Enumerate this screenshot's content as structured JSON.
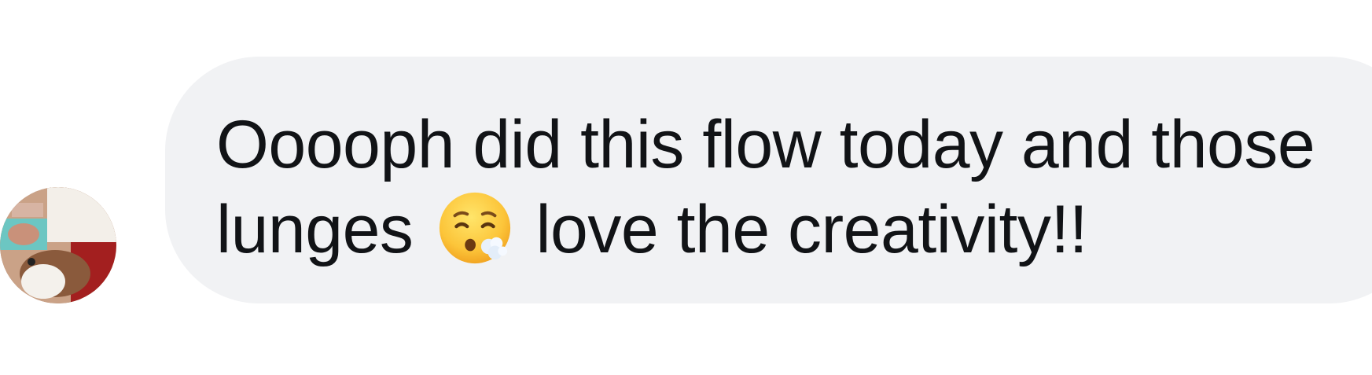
{
  "comment": {
    "text_before_emoji": "Ooooph did this flow today and those lunges",
    "emoji_icon": "exhaling-face-icon",
    "text_after_emoji": "love the creativity!!"
  },
  "avatar": {
    "icon": "avatar"
  },
  "colors": {
    "bubble_background": "#f1f2f4",
    "text": "#111316",
    "page_background": "#ffffff"
  }
}
